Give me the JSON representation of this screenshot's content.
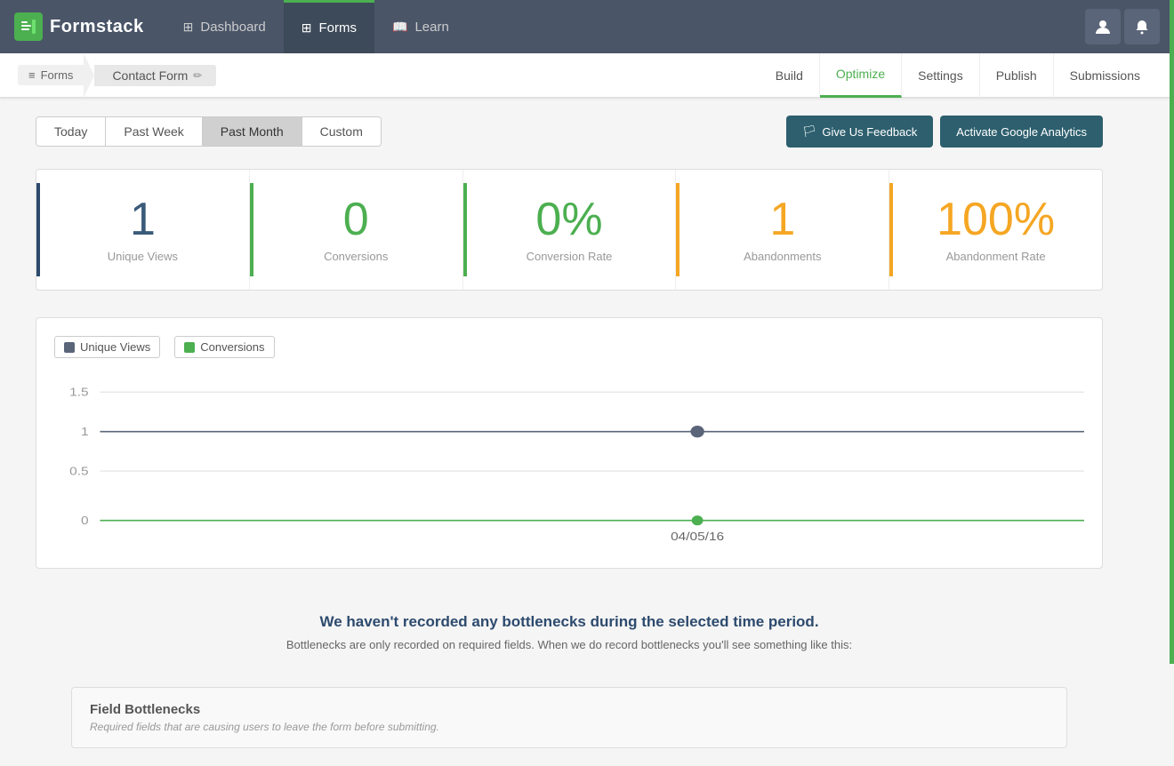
{
  "app": {
    "logo_text": "Formstack",
    "logo_icon": "f"
  },
  "top_nav": {
    "items": [
      {
        "id": "dashboard",
        "label": "Dashboard",
        "icon": "⊞",
        "active": false
      },
      {
        "id": "forms",
        "label": "Forms",
        "icon": "⊞",
        "active": true
      },
      {
        "id": "learn",
        "label": "Learn",
        "icon": "📖",
        "active": false
      }
    ],
    "user_icon": "👤",
    "bell_icon": "🔔"
  },
  "sub_nav": {
    "breadcrumb_root": "Forms",
    "breadcrumb_current": "Contact Form",
    "links": [
      {
        "id": "build",
        "label": "Build",
        "active": false
      },
      {
        "id": "optimize",
        "label": "Optimize",
        "active": false
      },
      {
        "id": "settings",
        "label": "Settings",
        "active": false
      },
      {
        "id": "publish",
        "label": "Publish",
        "active": false
      },
      {
        "id": "submissions",
        "label": "Submissions",
        "active": false
      }
    ]
  },
  "filter": {
    "tabs": [
      {
        "id": "today",
        "label": "Today",
        "active": false
      },
      {
        "id": "past-week",
        "label": "Past Week",
        "active": false
      },
      {
        "id": "past-month",
        "label": "Past Month",
        "active": true
      },
      {
        "id": "custom",
        "label": "Custom",
        "active": false
      }
    ],
    "feedback_btn": "Give Us Feedback",
    "analytics_btn": "Activate Google Analytics"
  },
  "stats": [
    {
      "id": "unique-views",
      "value": "1",
      "label": "Unique Views",
      "color": "color-dark",
      "border": "dark-blue"
    },
    {
      "id": "conversions",
      "value": "0",
      "label": "Conversions",
      "color": "color-green",
      "border": "green"
    },
    {
      "id": "conversion-rate",
      "value": "0%",
      "label": "Conversion Rate",
      "color": "color-green",
      "border": "green-light"
    },
    {
      "id": "abandonments",
      "value": "1",
      "label": "Abandonments",
      "color": "color-orange",
      "border": "orange"
    },
    {
      "id": "abandonment-rate",
      "value": "100%",
      "label": "Abandonment Rate",
      "color": "color-orange",
      "border": "orange-dark"
    }
  ],
  "chart": {
    "legend": [
      {
        "id": "unique-views",
        "label": "Unique Views",
        "color": "dark"
      },
      {
        "id": "conversions",
        "label": "Conversions",
        "color": "green"
      }
    ],
    "y_axis": [
      "1.5",
      "1",
      "0.5",
      "0"
    ],
    "data_point_date": "04/05/16",
    "data_point_x_pct": 58,
    "unique_views_y": 1,
    "conversions_y": 0
  },
  "bottleneck": {
    "title": "We haven't recorded any bottlenecks during the selected time period.",
    "subtitle": "Bottlenecks are only recorded on required fields. When we do record bottlenecks you'll see something like this:",
    "card_title": "Field Bottlenecks",
    "card_desc": "Required fields that are causing users to leave the form before submitting."
  }
}
